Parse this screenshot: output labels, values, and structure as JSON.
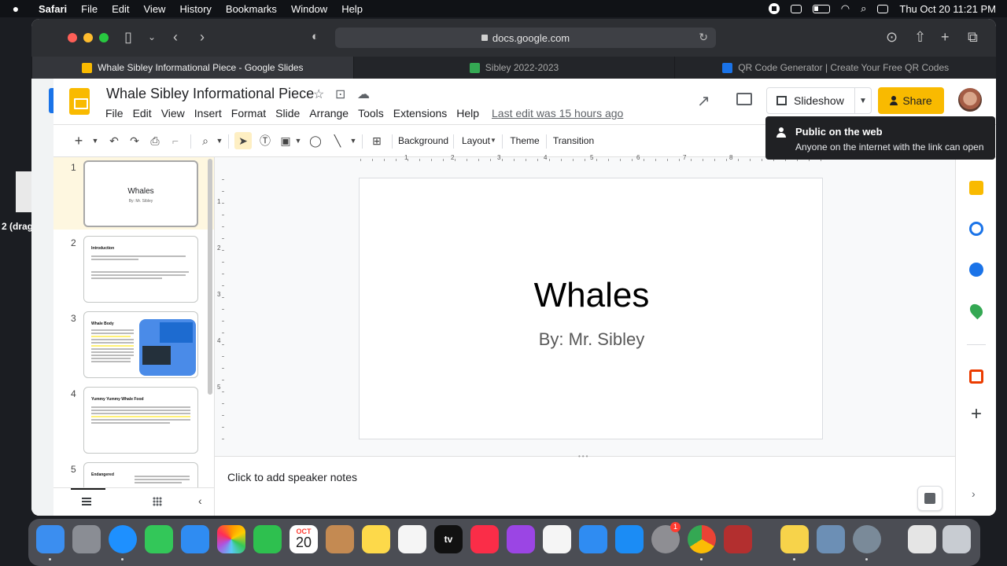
{
  "menubar": {
    "app": "Safari",
    "items": [
      "File",
      "Edit",
      "View",
      "History",
      "Bookmarks",
      "Window",
      "Help"
    ],
    "clock": "Thu Oct 20  11:21 PM"
  },
  "desktop": {
    "label": "2 (drag"
  },
  "browser": {
    "url": "docs.google.com",
    "tabs": [
      {
        "title": "Whale Sibley Informational Piece - Google Slides",
        "color": "#f9ba00",
        "active": true
      },
      {
        "title": "Sibley 2022-2023",
        "color": "#34a853",
        "active": false
      },
      {
        "title": "QR Code Generator | Create Your Free QR Codes",
        "color": "#1a73e8",
        "active": false
      }
    ]
  },
  "doc": {
    "title": "Whale Sibley Informational Piece",
    "menus": [
      "File",
      "Edit",
      "View",
      "Insert",
      "Format",
      "Slide",
      "Arrange",
      "Tools",
      "Extensions",
      "Help"
    ],
    "last_edit": "Last edit was 15 hours ago"
  },
  "header": {
    "slideshow_label": "Slideshow",
    "share_label": "Share"
  },
  "tooltip": {
    "title": "Public on the web",
    "description": "Anyone on the internet with the link can open"
  },
  "toolbar": {
    "background": "Background",
    "layout": "Layout",
    "theme": "Theme",
    "transition": "Transition"
  },
  "ruler": {
    "h": [
      "1",
      "2",
      "3",
      "4",
      "5",
      "6",
      "7",
      "8"
    ],
    "v": [
      "1",
      "2",
      "3",
      "4",
      "5"
    ]
  },
  "slides": [
    {
      "num": "1",
      "title": "Whales",
      "subtitle": "By: Mr. Sibley"
    },
    {
      "num": "2",
      "title": "Introduction"
    },
    {
      "num": "3",
      "title": "Whale Body"
    },
    {
      "num": "4",
      "title": "Yummy Yummy Whale Food"
    },
    {
      "num": "5",
      "title": "Endangered"
    }
  ],
  "main_slide": {
    "title": "Whales",
    "subtitle": "By: Mr. Sibley"
  },
  "notes": {
    "placeholder": "Click to add speaker notes"
  },
  "dock": {
    "calendar_month": "OCT",
    "calendar_day": "20",
    "tv_label": "tv",
    "settings_badge": "1"
  },
  "colors": {
    "share_accent": "#f9ba00",
    "selection": "#feefc3",
    "link_blue": "#1a73e8"
  }
}
